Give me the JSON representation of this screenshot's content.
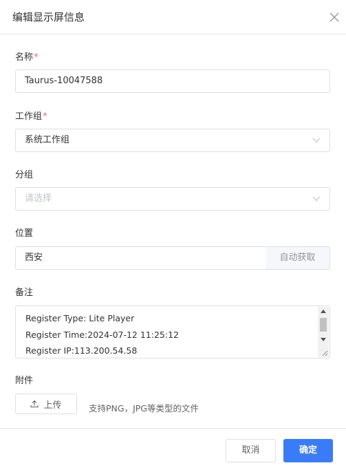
{
  "dialog": {
    "title": "编辑显示屏信息",
    "close_icon": "close-icon"
  },
  "form": {
    "name": {
      "label": "名称",
      "required_mark": "*",
      "value": "Taurus-10047588"
    },
    "workgroup": {
      "label": "工作组",
      "required_mark": "*",
      "value": "系统工作组",
      "icon": "chevron-down-icon"
    },
    "group": {
      "label": "分组",
      "placeholder": "请选择",
      "icon": "chevron-down-icon"
    },
    "location": {
      "label": "位置",
      "value": "西安",
      "auto_button": "自动获取"
    },
    "notes": {
      "label": "备注",
      "lines": [
        "Register Type: Lite Player",
        "Register Time:2024-07-12 11:25:12",
        "Register IP:113.200.54.58"
      ]
    },
    "attachment": {
      "label": "附件",
      "upload_button": "上传",
      "upload_icon": "upload-icon",
      "tip": "支持PNG，JPG等类型的文件"
    }
  },
  "footer": {
    "cancel": "取消",
    "confirm": "确定"
  },
  "colors": {
    "primary": "#3a7cf7",
    "required": "#f56c6c",
    "border": "#dcdfe6",
    "placeholder": "#c0c4cc"
  }
}
